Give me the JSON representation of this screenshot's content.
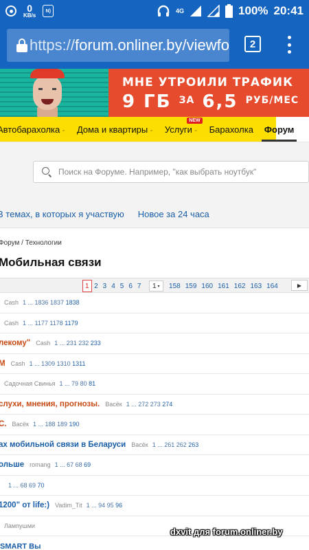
{
  "statusbar": {
    "speed_value": "0",
    "speed_unit": "KB/s",
    "nfc": "N)",
    "network": "4G",
    "battery": "100%",
    "time": "20:41"
  },
  "browser": {
    "url_proto": "https://",
    "url_host": "forum.onliner.by/viewfo",
    "tab_count": "2"
  },
  "banner": {
    "line1": "МНЕ УТРОИЛИ ТРАФИК",
    "line2_a": "9 ГБ",
    "line2_b": "ЗА",
    "line2_c": "6,5",
    "line2_d": "РУБ/МЕС"
  },
  "nav": {
    "items": [
      {
        "label": "Автобарахолка",
        "caret": "⌄"
      },
      {
        "label": "Дома и квартиры",
        "caret": "⌄"
      },
      {
        "label": "Услуги",
        "caret": "⌄",
        "badge": "NEW"
      },
      {
        "label": "Барахолка"
      },
      {
        "label": "Форум"
      }
    ]
  },
  "search": {
    "placeholder": "Поиск на Форуме. Например, \"как выбрать ноутбук\""
  },
  "forum_tabs": {
    "tab1": "В темах, в которых я участвую",
    "tab2": "Новое за 24 часа"
  },
  "breadcrumb": "Форум / Технологии",
  "page_title": "Мобильная связи",
  "pagination": {
    "pages_before": [
      "1",
      "2",
      "3",
      "4",
      "5",
      "6",
      "7"
    ],
    "dropdown": "1",
    "dropdown_arrow": "▾",
    "pages_after": [
      "158",
      "159",
      "160",
      "161",
      "162",
      "163",
      "164"
    ],
    "next": "▶"
  },
  "topics": [
    {
      "title": "",
      "author": "Cash",
      "pages": "1 ... 1836 1837 ",
      "last": "1838",
      "hot": false
    },
    {
      "title": "",
      "author": "Cash",
      "pages": "1 ... 1177 1178 ",
      "last": "1179",
      "hot": false
    },
    {
      "title": "лекому\"",
      "author": "Cash",
      "pages": "1 ... 231 232 ",
      "last": "233",
      "hot": true
    },
    {
      "title": "М",
      "author": "Cash",
      "pages": "1 ... 1309 1310 ",
      "last": "1311",
      "hot": true
    },
    {
      "title": "",
      "author": "Садочная Свинья",
      "pages": "1 ... 79 80 ",
      "last": "81",
      "hot": false
    },
    {
      "title": "слухи, мнения, прогнозы.",
      "author": "Васёк",
      "pages": "1 ... 272 273 ",
      "last": "274",
      "hot": true
    },
    {
      "title": "С.",
      "author": "Васёк",
      "pages": "1 ... 188 189 ",
      "last": "190",
      "hot": true
    },
    {
      "title": "ах мобильной связи в Беларуси",
      "author": "Васёк",
      "pages": "1 ... 261 262 ",
      "last": "263",
      "hot": false
    },
    {
      "title": "ольше",
      "author": "romang",
      "pages": "1 ... 67 68 ",
      "last": "69",
      "hot": false
    },
    {
      "title": "",
      "author": "",
      "pages": "1 ... 68 69 ",
      "last": "70",
      "hot": false
    },
    {
      "title": "1200\" от life:)",
      "author": "Vadim_Tit",
      "pages": "1 ... 94 95 ",
      "last": "96",
      "hot": false
    },
    {
      "title": "",
      "author": "Лампушми",
      "pages": "",
      "last": "",
      "hot": false
    }
  ],
  "cut_row": "SMART Вы",
  "watermark": "dxvit для forum.onliner.by"
}
